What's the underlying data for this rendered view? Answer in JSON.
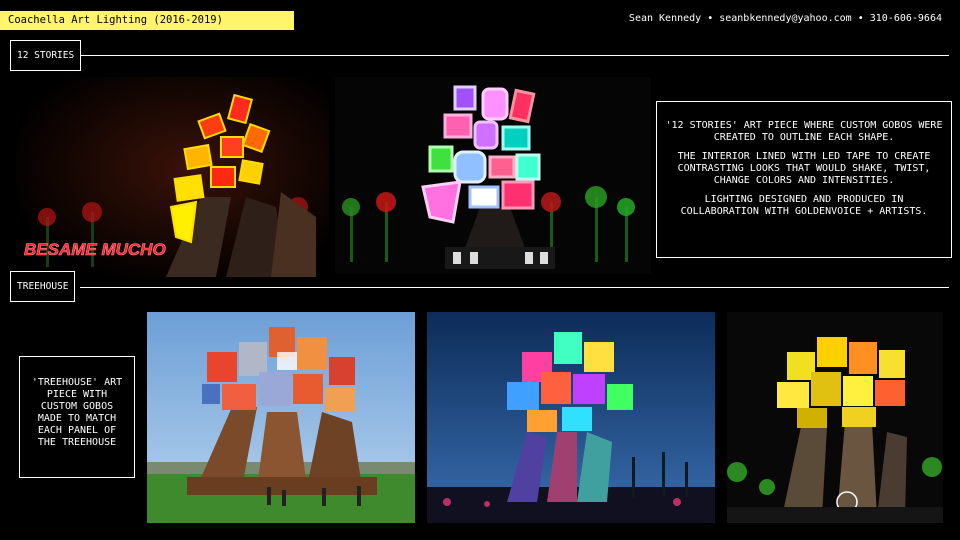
{
  "header": {
    "title": "Coachella Art Lighting (2016-2019)",
    "contact": "Sean Kennedy • seanbkennedy@yahoo.com • 310-606-9664"
  },
  "sections": {
    "stories": {
      "label": "12 STORIES",
      "description": [
        "'12 STORIES' ART PIECE WHERE CUSTOM GOBOS WERE CREATED TO OUTLINE EACH SHAPE.",
        "THE INTERIOR LINED WITH LED TAPE TO CREATE CONTRASTING LOOKS THAT WOULD SHAKE, TWIST, CHANGE COLORS AND INTENSITIES.",
        "LIGHTING DESIGNED AND PRODUCED IN COLLABORATION WITH GOLDENVOICE + ARTISTS."
      ],
      "neon_sign": "BESAME MUCHO"
    },
    "treehouse": {
      "label": "TREEHOUSE",
      "description": "'TREEHOUSE' ART PIECE WITH CUSTOM GOBOS MADE TO MATCH EACH PANEL OF THE TREEHOUSE"
    }
  },
  "colors": {
    "accent": "#fff46a",
    "background": "#000000",
    "text": "#ffffff"
  }
}
